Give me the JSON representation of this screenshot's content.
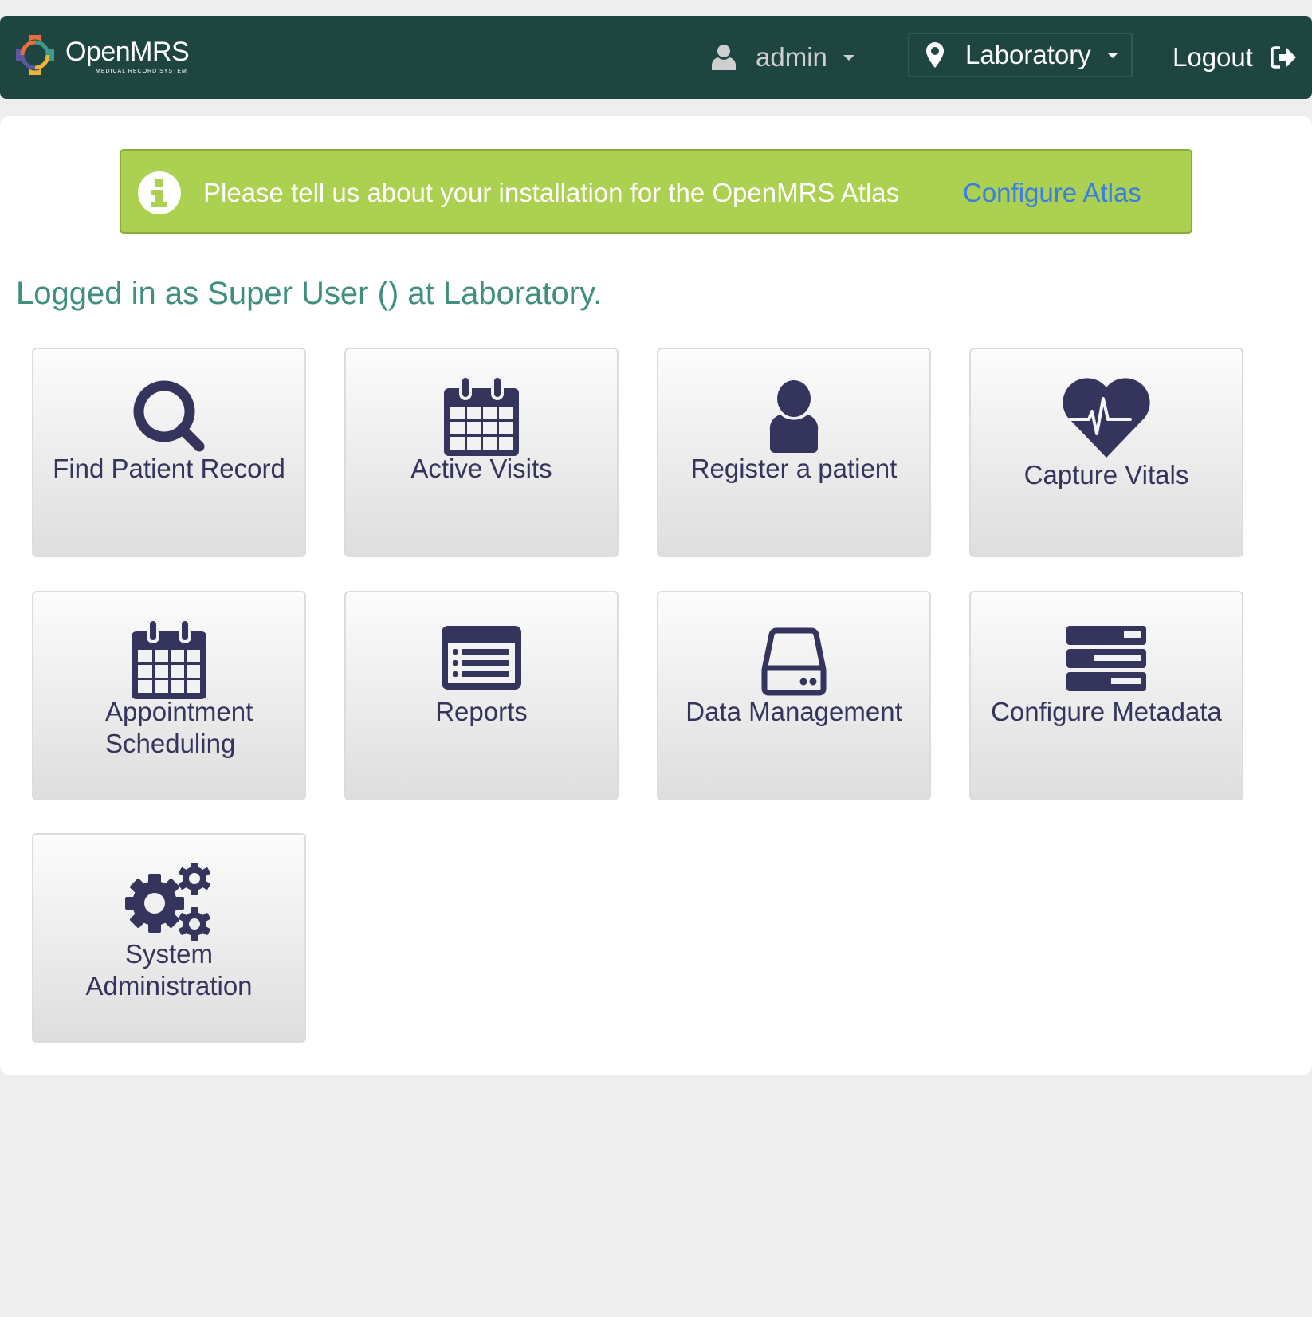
{
  "header": {
    "logo_text": "OpenMRS",
    "logo_subtitle": "MEDICAL RECORD SYSTEM",
    "user_label": "admin",
    "location_label": "Laboratory",
    "logout_label": "Logout",
    "background_color": "#1e4540"
  },
  "banner": {
    "message": "Please tell us about your installation for the OpenMRS Atlas",
    "link_label": "Configure Atlas",
    "background_color": "#acd04f",
    "link_color": "#3a7de8"
  },
  "welcome": {
    "text": "Logged in as Super User () at Laboratory."
  },
  "apps": [
    {
      "label": "Find Patient Record",
      "icon": "search-icon"
    },
    {
      "label": "Active Visits",
      "icon": "calendar-icon"
    },
    {
      "label": "Register a patient",
      "icon": "user-icon"
    },
    {
      "label": "Capture Vitals",
      "icon": "heartbeat-icon"
    },
    {
      "label": "Appointment Scheduling",
      "icon": "calendar-icon"
    },
    {
      "label": "Reports",
      "icon": "list-icon"
    },
    {
      "label": "Data Management",
      "icon": "hdd-icon"
    },
    {
      "label": "Configure Metadata",
      "icon": "server-icon"
    },
    {
      "label": "System Administration",
      "icon": "gears-icon"
    }
  ]
}
